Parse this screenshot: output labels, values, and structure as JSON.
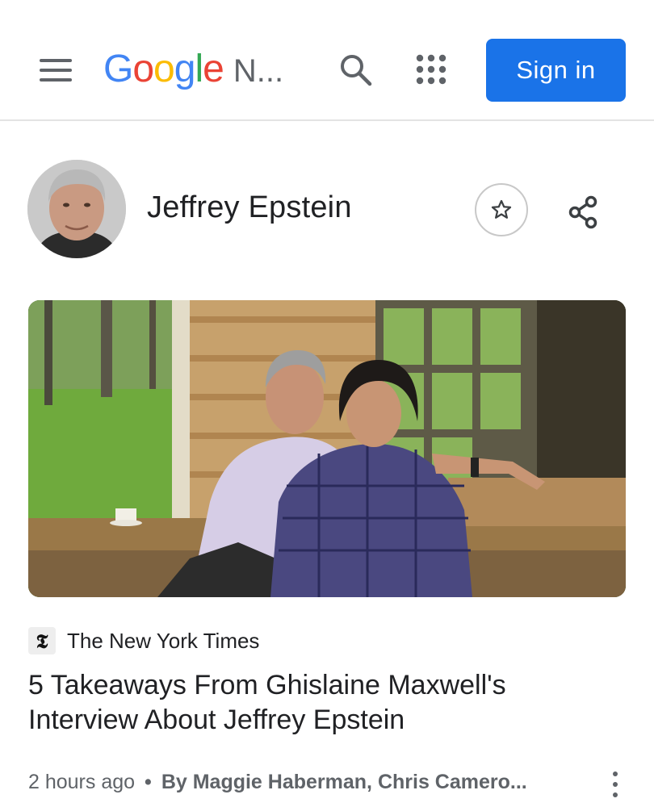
{
  "header": {
    "logo_parts": [
      "G",
      "o",
      "o",
      "g",
      "l",
      "e"
    ],
    "logo_suffix": "N...",
    "signin_label": "Sign in"
  },
  "topic": {
    "title": "Jeffrey Epstein"
  },
  "article": {
    "source": "The New York Times",
    "source_logo_glyph": "𝕿",
    "headline": "5 Takeaways From Ghislaine Maxwell's Interview About Jeffrey Epstein",
    "time": "2 hours ago",
    "separator": "•",
    "byline": "By Maggie Haberman, Chris Camero..."
  },
  "colors": {
    "accent": "#1a73e8",
    "google_blue": "#4285f4",
    "google_red": "#ea4335",
    "google_yellow": "#fbbc05",
    "google_green": "#34a853",
    "icon_gray": "#5f6368"
  },
  "icons": [
    "menu-icon",
    "search-icon",
    "apps-grid-icon",
    "star-icon",
    "share-icon",
    "more-vert-icon"
  ]
}
